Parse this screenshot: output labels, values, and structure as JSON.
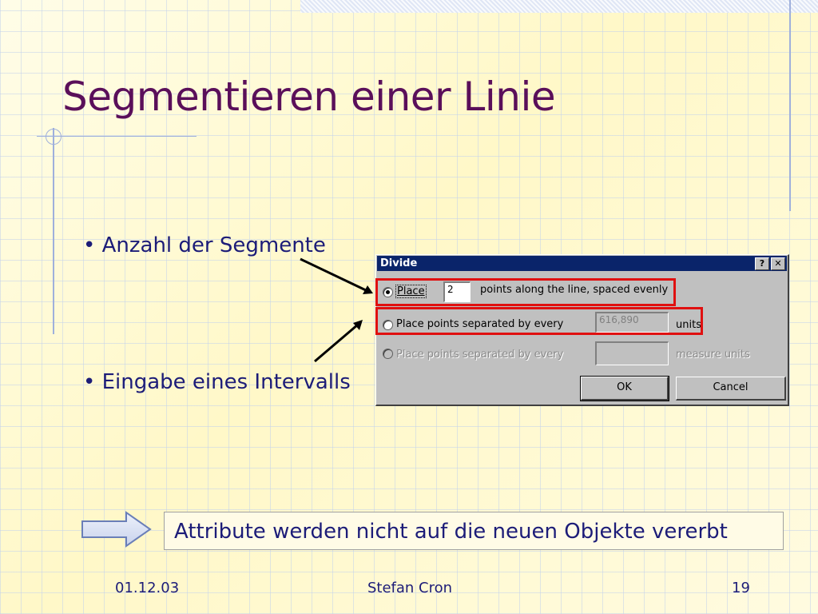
{
  "slide": {
    "title": "Segmentieren einer Linie",
    "bullets": [
      "• Anzahl der Segmente",
      "• Eingabe eines Intervalls"
    ],
    "note": "Attribute werden nicht auf die neuen Objekte vererbt"
  },
  "dialog": {
    "title": "Divide",
    "help_label": "?",
    "close_label": "✕",
    "option1": {
      "label": "Place",
      "value": "2",
      "suffix": "points along the line, spaced evenly",
      "selected": true
    },
    "option2": {
      "label": "Place points separated by every",
      "value": "616,890",
      "suffix": "units",
      "selected": false
    },
    "option3": {
      "label": "Place points separated by every",
      "value": "",
      "suffix": "measure units",
      "enabled": false
    },
    "ok_label": "OK",
    "cancel_label": "Cancel"
  },
  "footer": {
    "date": "01.12.03",
    "author": "Stefan Cron",
    "page": "19"
  },
  "colors": {
    "title": "#5a0f5a",
    "text": "#1c1c78",
    "highlight": "#e01010",
    "dialog_titlebar": "#0a246a"
  }
}
